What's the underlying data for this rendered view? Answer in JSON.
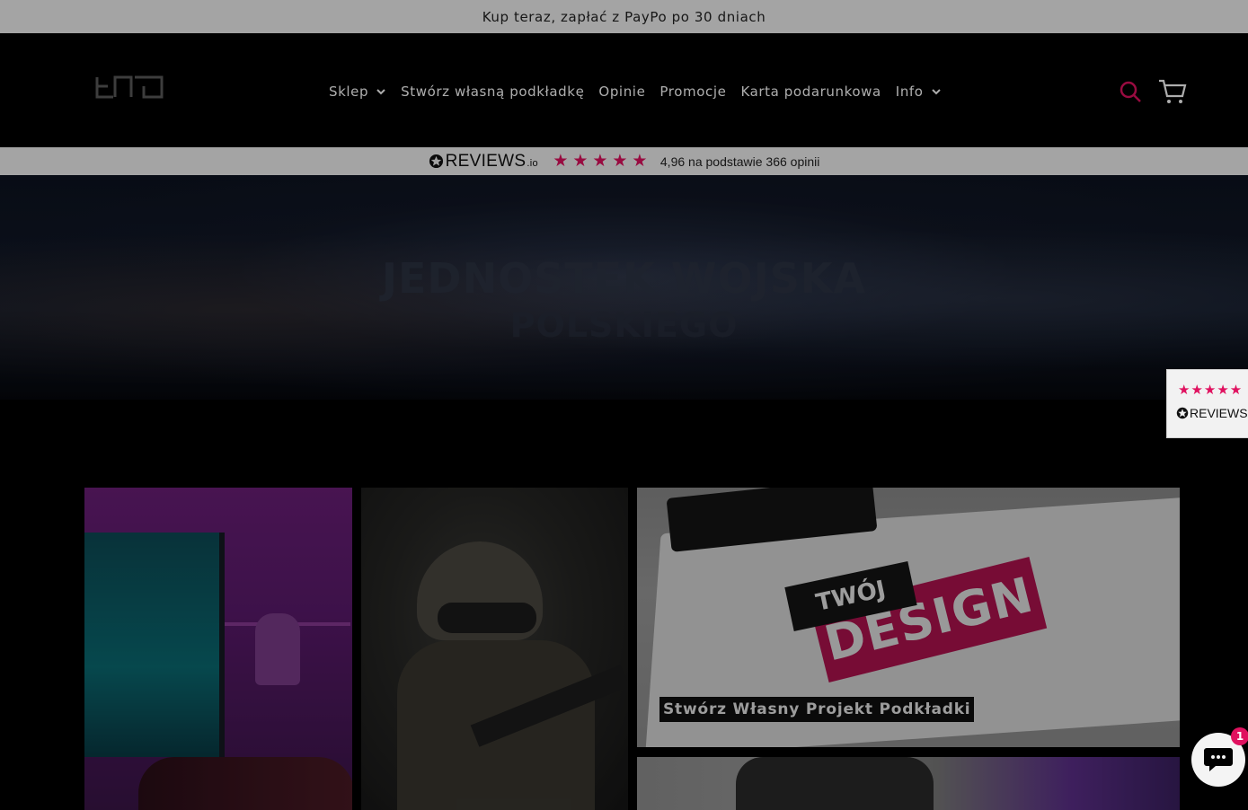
{
  "announcement": {
    "text": "Kup teraz, zapłać z PayPo po 30 dniach"
  },
  "header": {
    "logo_alt": "tnt",
    "nav": [
      {
        "label": "Sklep",
        "has_dropdown": true
      },
      {
        "label": "Stwórz własną podkładkę",
        "has_dropdown": false
      },
      {
        "label": "Opinie",
        "has_dropdown": false
      },
      {
        "label": "Promocje",
        "has_dropdown": false
      },
      {
        "label": "Karta podarunkowa",
        "has_dropdown": false
      },
      {
        "label": "Info",
        "has_dropdown": true
      }
    ],
    "icons": {
      "search": "search-icon",
      "cart": "cart-icon"
    },
    "accent_color": "#e0115f"
  },
  "reviews_bar": {
    "brand": "REVIEWS",
    "brand_suffix": ".io",
    "stars": [
      "★",
      "★",
      "★",
      "★",
      "★"
    ],
    "rating_text": "4,96 na podstawie 366 opinii",
    "star_color": "#e0115f"
  },
  "hero": {
    "title": "JEDNOSTEK WOJSKA",
    "subtitle": "POLSKIEGO"
  },
  "side_reviews_tab": {
    "stars": "★★★★★",
    "brand": "REVIEWS"
  },
  "tiles": {
    "design_caption": "Stwórz Własny Projekt Podkładki",
    "design_badge_top": "TWÓJ",
    "design_badge_main": "DESIGN"
  },
  "chat": {
    "badge_count": "1"
  }
}
